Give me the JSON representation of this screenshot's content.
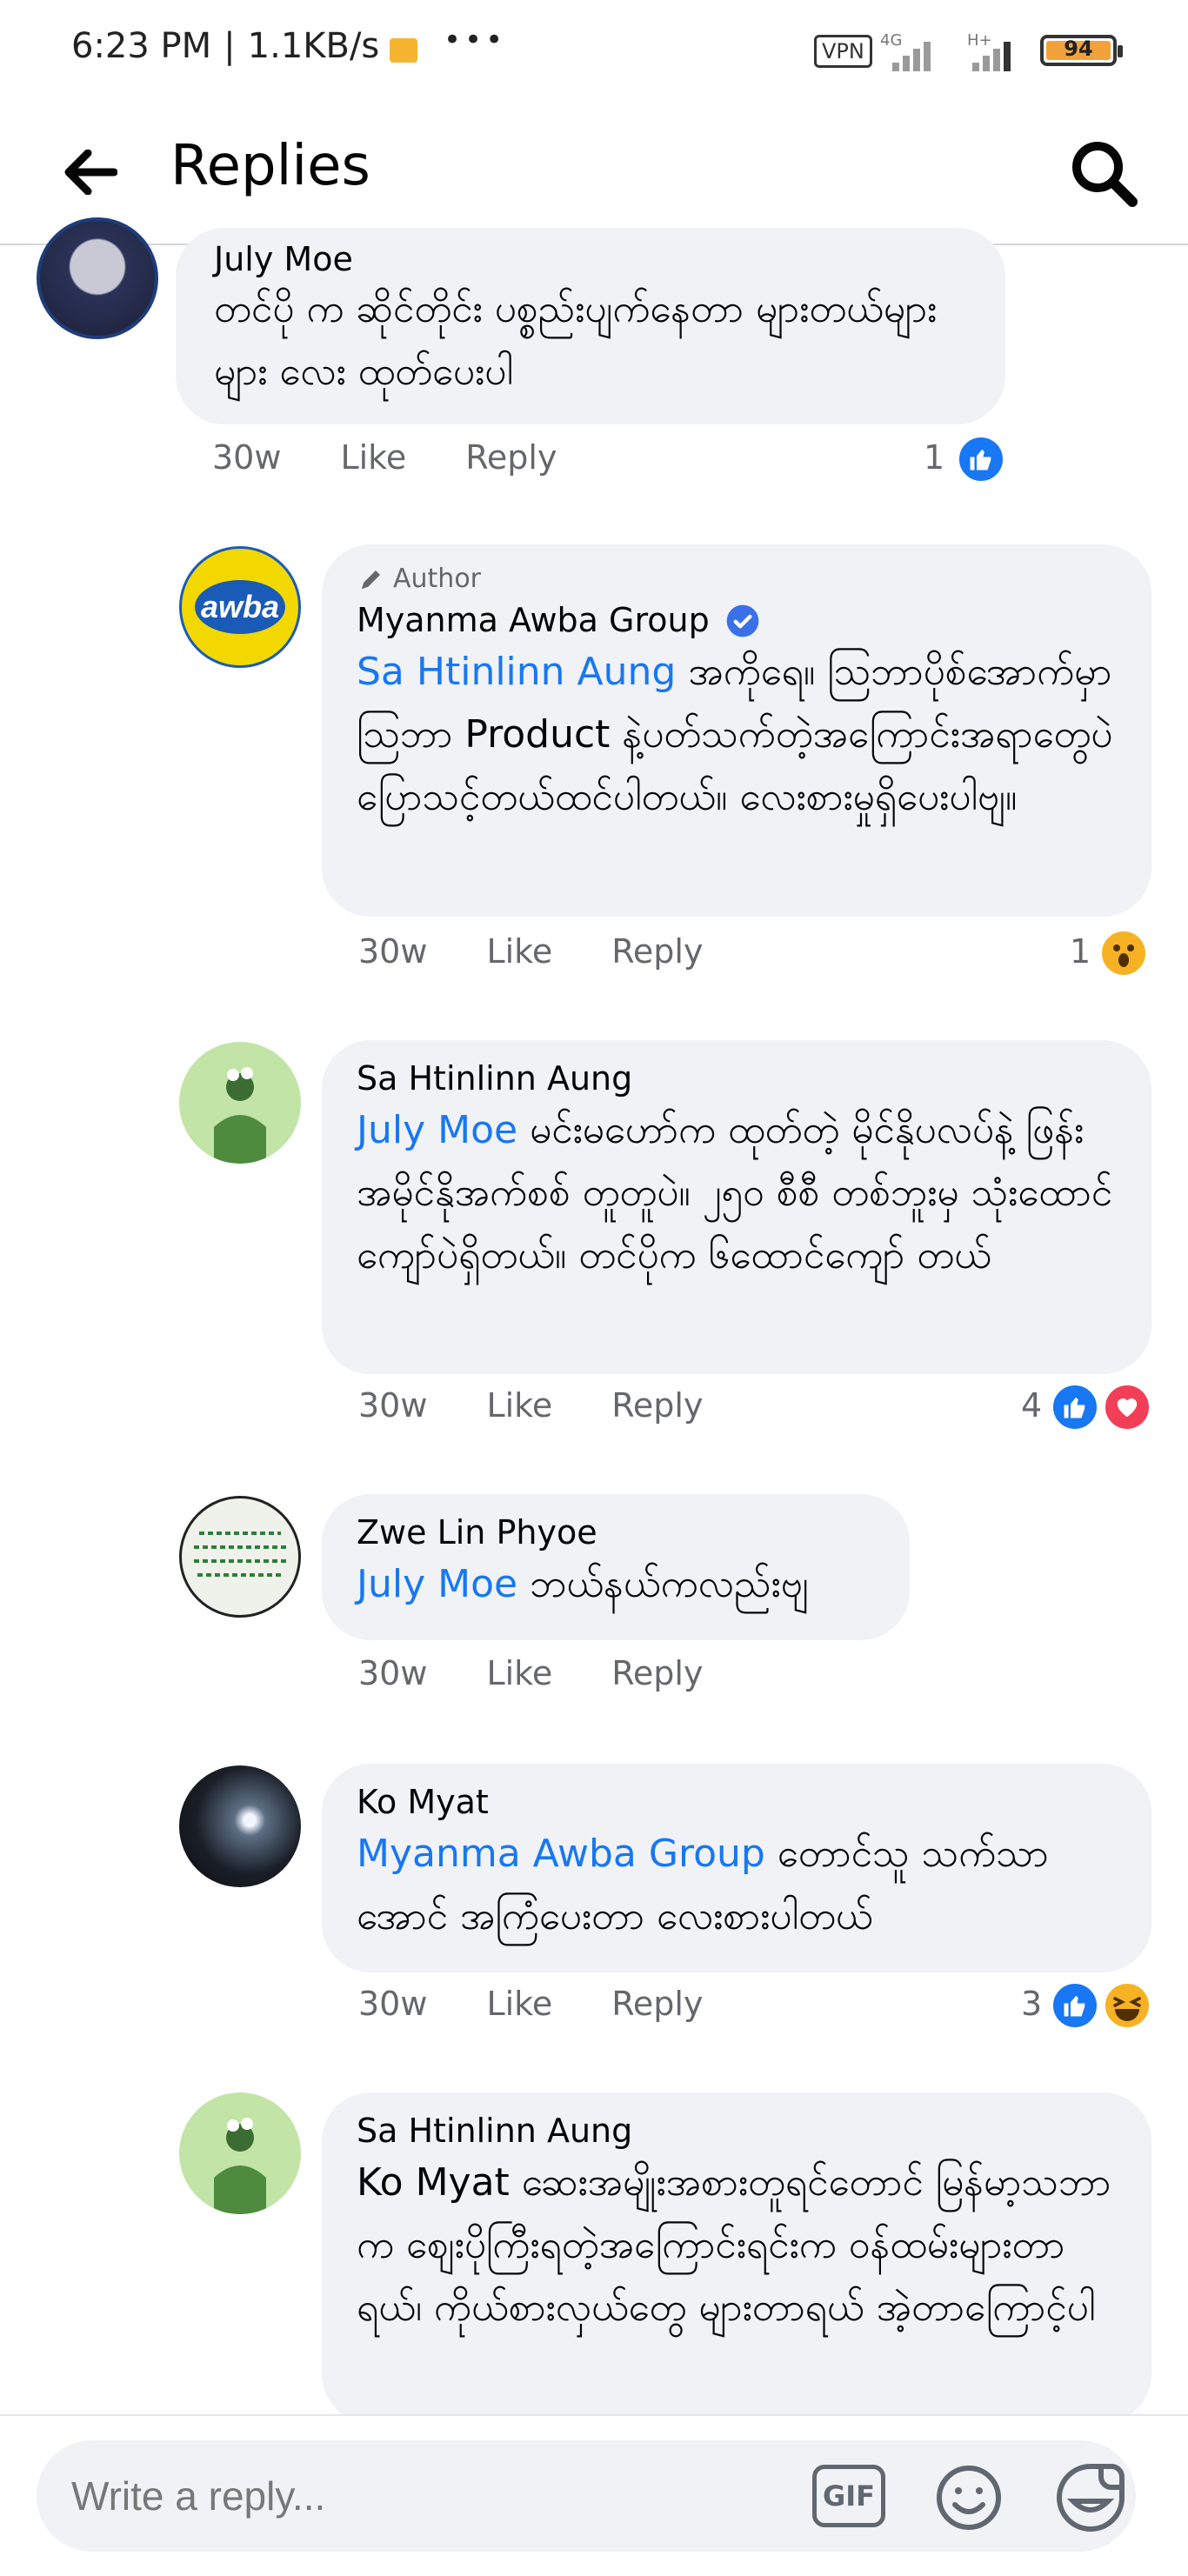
{
  "status_bar": {
    "time": "6:23 PM",
    "speed": "1.1KB/s",
    "dots": "•••",
    "vpn": "VPN",
    "net1": "4G",
    "net2": "H+",
    "battery": "94"
  },
  "header": {
    "title": "Replies"
  },
  "comments": [
    {
      "name": "July Moe",
      "text": "တင်ပို က ဆိုင်တိုင်း ပစ္စည်းပျက်နေတာ များတယ်များများ လေး ထုတ်ပေးပါ",
      "time": "30w",
      "like": "Like",
      "reply": "Reply",
      "count": "1"
    },
    {
      "badge": "Author",
      "name": "Myanma Awba Group",
      "mention": "Sa Htinlinn Aung",
      "text": " အကိုရေ။ ဩဘာပိုစ်အောက်မှာ ဩဘာ Product နဲ့ပတ်သက်တဲ့အကြောင်းအရာတွေပဲပြောသင့်တယ်ထင်ပါတယ်။ လေးစားမှုရှိပေးပါဗျ။",
      "time": "30w",
      "like": "Like",
      "reply": "Reply",
      "count": "1",
      "logo_text": "awba"
    },
    {
      "name": "Sa Htinlinn Aung",
      "mention": "July Moe",
      "text": " မင်းမဟော်က ထုတ်တဲ့ မိုင်နိုပလပ်နဲ့ ဖြန်း အမိုင်နိုအက်စစ် တူတူပဲ။ ၂၅၀ စီစီ တစ်ဘူးမှ သုံးထောင်ကျော်ပဲရှိတယ်။ တင်ပိုက ၆ထောင်ကျော် တယ်",
      "time": "30w",
      "like": "Like",
      "reply": "Reply",
      "count": "4"
    },
    {
      "name": "Zwe Lin Phyoe",
      "mention": "July Moe",
      "text": " ဘယ်နယ်ကလည်းဗျ",
      "time": "30w",
      "like": "Like",
      "reply": "Reply"
    },
    {
      "name": "Ko Myat",
      "mention": "Myanma Awba Group",
      "text": " တောင်သူ သက်သာအောင် အကြံပေးတာ  လေးစားပါတယ်",
      "time": "30w",
      "like": "Like",
      "reply": "Reply",
      "count": "3"
    },
    {
      "name": "Sa Htinlinn Aung",
      "text": "Ko Myat ဆေးအမျိုးအစားတူရင်တောင် မြန်မာ့သဘာက စျေးပိုကြီးရတဲ့အကြောင်းရင်းက ဝန်ထမ်းများတာရယ်၊ ကိုယ်စားလှယ်တွေ များတာရယ် အဲ့တာကြောင့်ပါ"
    }
  ],
  "composer": {
    "placeholder": "Write a reply...",
    "gif_label": "GIF"
  },
  "colors": {
    "accent": "#1877f2",
    "bubble": "#f0f2f5",
    "meta": "#65676b"
  }
}
